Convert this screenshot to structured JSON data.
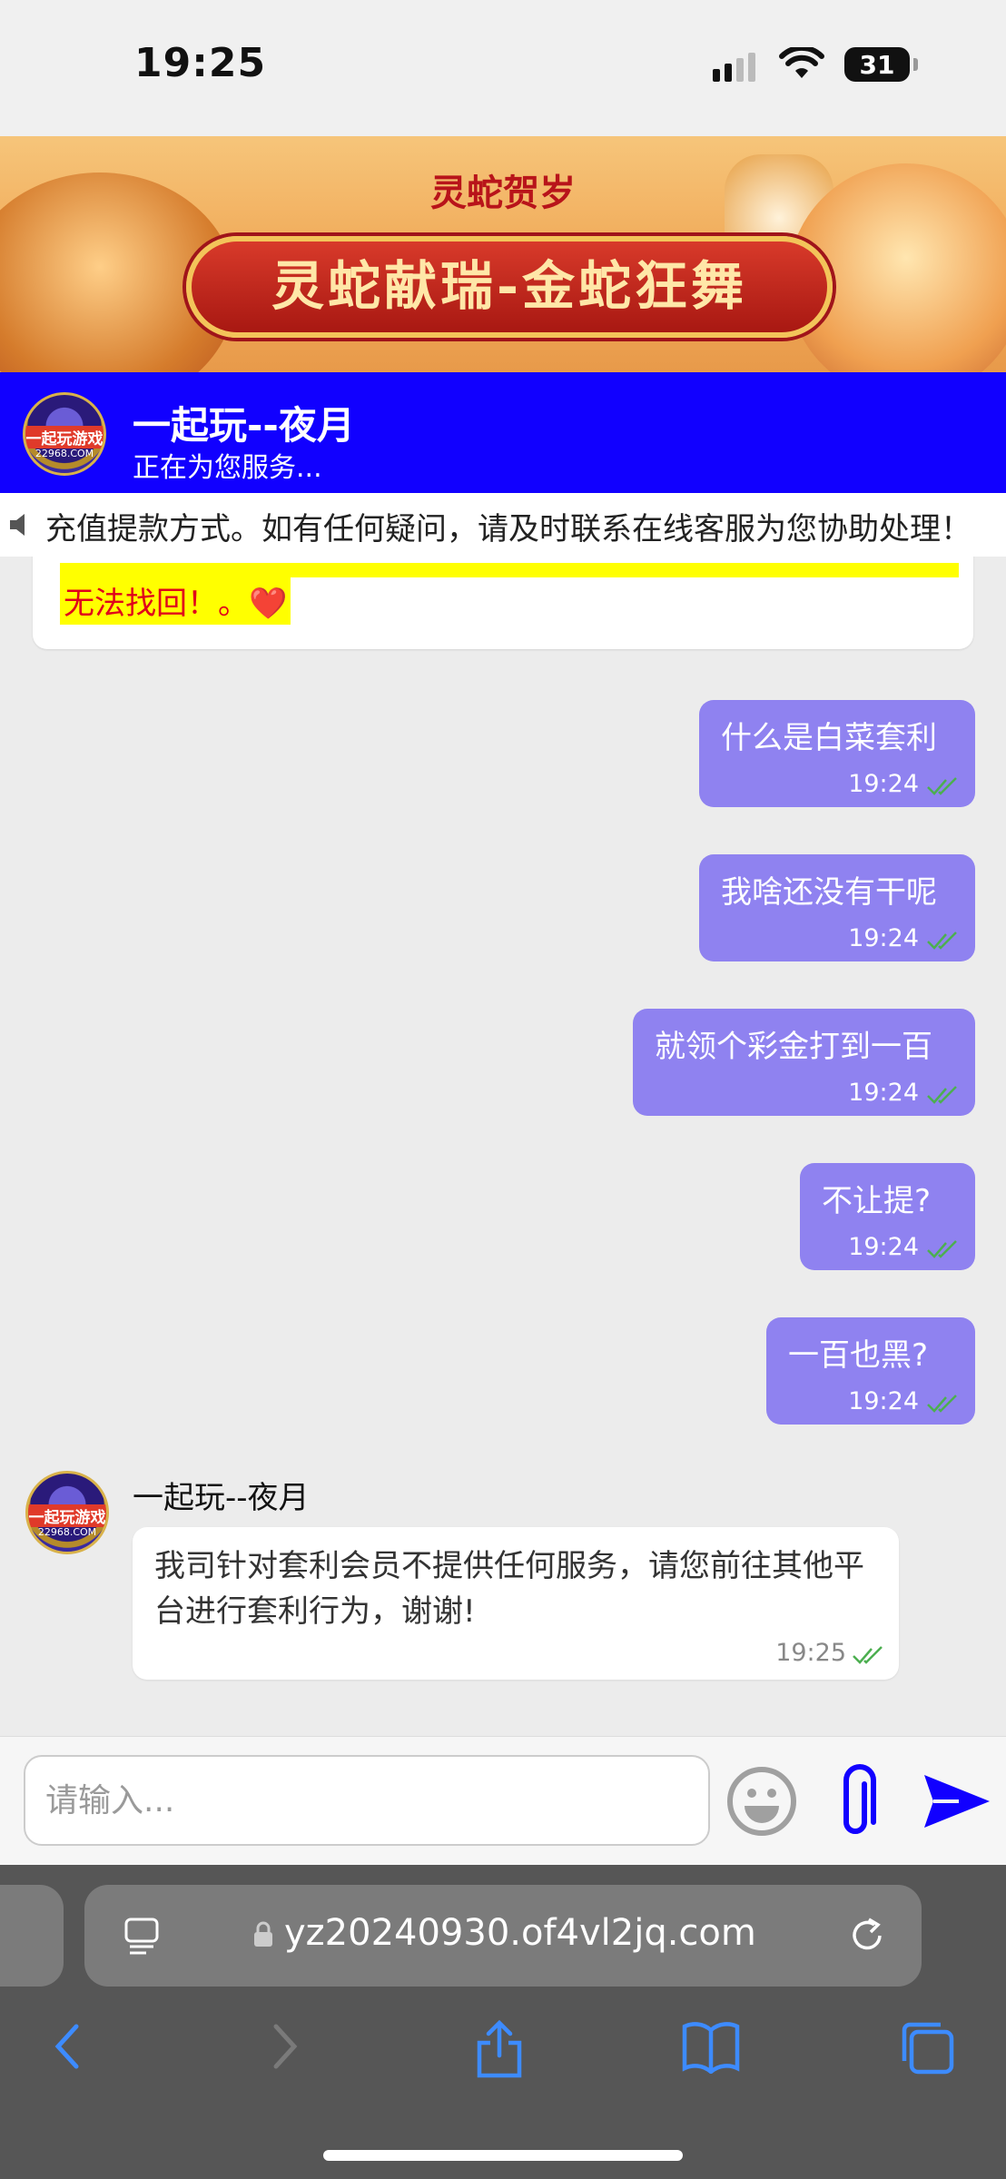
{
  "status_bar": {
    "time": "19:25",
    "battery": "31"
  },
  "banner": {
    "small_title": "灵蛇贺岁",
    "title": "灵蛇献瑞-金蛇狂舞",
    "logo_text": "一起玩游戏",
    "logo_domain": "22968.COM"
  },
  "header": {
    "name": "一起玩--夜月",
    "status": "正在为您服务..."
  },
  "notice": {
    "text": "充值提款方式。如有任何疑问，请及时联系在线客服为您协助处理！"
  },
  "previous_message": {
    "tail_text": "无法找回！。❤️"
  },
  "messages": [
    {
      "text": "什么是白菜套利",
      "time": "19:24"
    },
    {
      "text": "我啥还没有干呢",
      "time": "19:24"
    },
    {
      "text": "就领个彩金打到一百",
      "time": "19:24"
    },
    {
      "text": "不让提?",
      "time": "19:24"
    },
    {
      "text": "一百也黑?",
      "time": "19:24"
    }
  ],
  "agent_reply": {
    "name": "一起玩--夜月",
    "text": "我司针对套利会员不提供任何服务，请您前往其他平台进行套利行为，谢谢!",
    "time": "19:25"
  },
  "input": {
    "placeholder": "请输入..."
  },
  "browser": {
    "url": "yz20240930.of4vl2jq.com"
  },
  "colors": {
    "header_bg": "#1100ff",
    "bubble": "#8f82f0",
    "send": "#1100ff",
    "check": "#4caf50"
  }
}
